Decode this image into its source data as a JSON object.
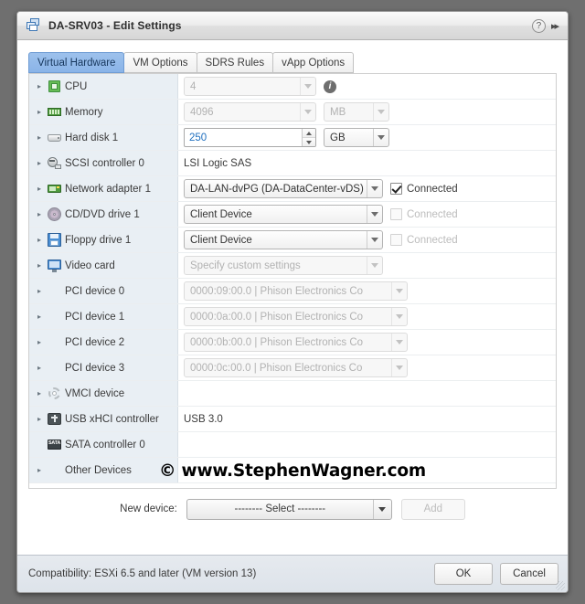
{
  "window": {
    "title": "DA-SRV03 - Edit Settings",
    "icon": "vm-icon",
    "help_label": "?",
    "expand_label": "▸▸"
  },
  "tabs": [
    {
      "label": "Virtual Hardware",
      "active": true
    },
    {
      "label": "VM Options",
      "active": false
    },
    {
      "label": "SDRS Rules",
      "active": false
    },
    {
      "label": "vApp Options",
      "active": false
    }
  ],
  "devices": [
    {
      "label": "CPU",
      "icon": "cpu-icon",
      "value": "4",
      "control": "select-disabled",
      "extra": "info"
    },
    {
      "label": "Memory",
      "icon": "memory-icon",
      "value": "4096",
      "control": "select-disabled",
      "unit": "MB",
      "unit_state": "disabled"
    },
    {
      "label": "Hard disk 1",
      "icon": "hard-disk-icon",
      "value": "250",
      "control": "spinner",
      "unit": "GB",
      "unit_state": "enabled"
    },
    {
      "label": "SCSI controller 0",
      "icon": "scsi-controller-icon",
      "value": "LSI Logic SAS",
      "control": "text"
    },
    {
      "label": "Network adapter 1",
      "icon": "network-adapter-icon",
      "value": "DA-LAN-dvPG (DA-DataCenter-vDS)",
      "control": "select",
      "checkbox": {
        "label": "Connected",
        "checked": true,
        "disabled": false
      }
    },
    {
      "label": "CD/DVD drive 1",
      "icon": "cd-dvd-icon",
      "value": "Client Device",
      "control": "select",
      "checkbox": {
        "label": "Connected",
        "checked": false,
        "disabled": true
      }
    },
    {
      "label": "Floppy drive 1",
      "icon": "floppy-icon",
      "value": "Client Device",
      "control": "select",
      "checkbox": {
        "label": "Connected",
        "checked": false,
        "disabled": true
      }
    },
    {
      "label": "Video card",
      "icon": "video-card-icon",
      "value": "Specify custom settings",
      "control": "select-disabled"
    },
    {
      "label": "PCI device 0",
      "icon": "none",
      "value": "0000:09:00.0 | Phison Electronics Co",
      "control": "select-disabled"
    },
    {
      "label": "PCI device 1",
      "icon": "none",
      "value": "0000:0a:00.0 | Phison Electronics Co",
      "control": "select-disabled"
    },
    {
      "label": "PCI device 2",
      "icon": "none",
      "value": "0000:0b:00.0 | Phison Electronics Co",
      "control": "select-disabled"
    },
    {
      "label": "PCI device 3",
      "icon": "none",
      "value": "0000:0c:00.0 | Phison Electronics Co",
      "control": "select-disabled"
    },
    {
      "label": "VMCI device",
      "icon": "vmci-icon",
      "value": "",
      "control": "none"
    },
    {
      "label": "USB xHCI controller",
      "icon": "usb-icon",
      "value": "USB 3.0",
      "control": "text"
    },
    {
      "label": "SATA controller 0",
      "icon": "sata-icon",
      "value": "",
      "control": "none",
      "no_twisty": true
    },
    {
      "label": "Other Devices",
      "icon": "none",
      "value": "",
      "control": "none"
    }
  ],
  "watermark": "© www.StephenWagner.com",
  "new_device": {
    "label": "New device:",
    "selected": "-------- Select --------",
    "add_label": "Add",
    "add_disabled": true
  },
  "footer": {
    "compatibility": "Compatibility: ESXi 6.5 and later (VM version 13)",
    "ok_label": "OK",
    "cancel_label": "Cancel"
  },
  "colors": {
    "accent_tab": "#8ab4e8",
    "label_column": "#e9eff4",
    "footer": "#e2e7ed",
    "value_text": "#3a3a3a",
    "spinner_text": "#1f6fbf"
  }
}
